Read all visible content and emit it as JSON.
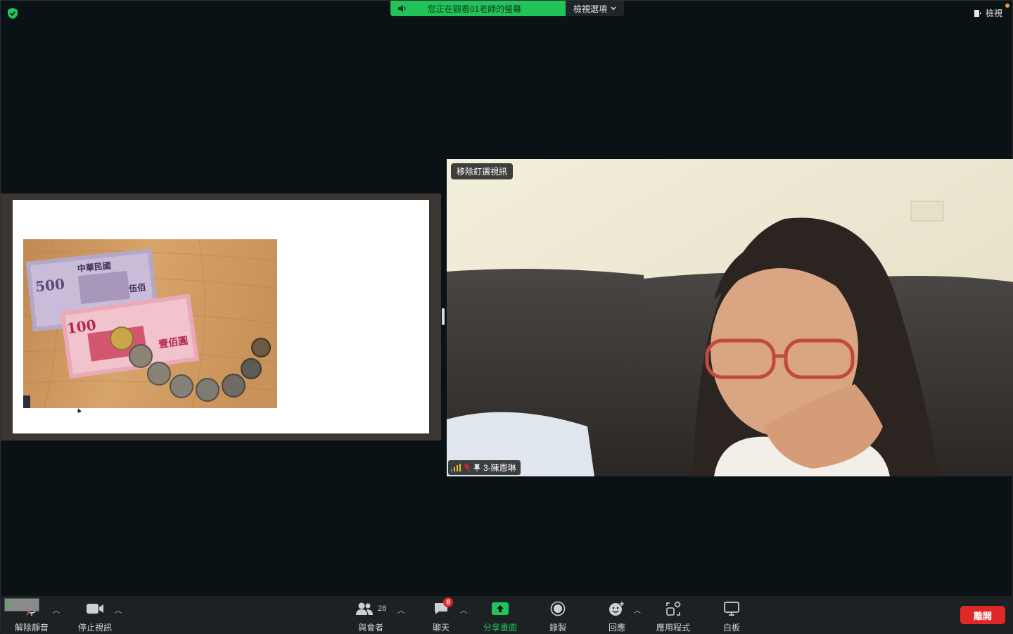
{
  "top_bar": {
    "viewing_banner": "您正在觀看01老師的螢幕",
    "view_options": "檢視選項",
    "view_button": "檢視"
  },
  "video": {
    "pin_badge": "移除釘選視訊",
    "participant_name": "3-陳恩琳"
  },
  "slide": {
    "banknote_500": "500",
    "banknote_100": "100",
    "banknote_100_text": "壹佰圓",
    "banknote_500_text": "伍佰",
    "bank_name": "中華民國"
  },
  "toolbar": {
    "mute_label": "解除靜音",
    "video_label": "停止視訊",
    "participants_label": "與會者",
    "participants_count": "28",
    "chat_label": "聊天",
    "chat_badge": "8",
    "share_label": "分享畫面",
    "record_label": "錄製",
    "reactions_label": "回應",
    "apps_label": "應用程式",
    "whiteboard_label": "白板",
    "leave_label": "離開",
    "mini_label": "$"
  },
  "colors": {
    "accent_green": "#22c45a",
    "leave_red": "#e02828",
    "toolbar_bg": "#1c2124",
    "stage_bg": "#0b1216"
  }
}
